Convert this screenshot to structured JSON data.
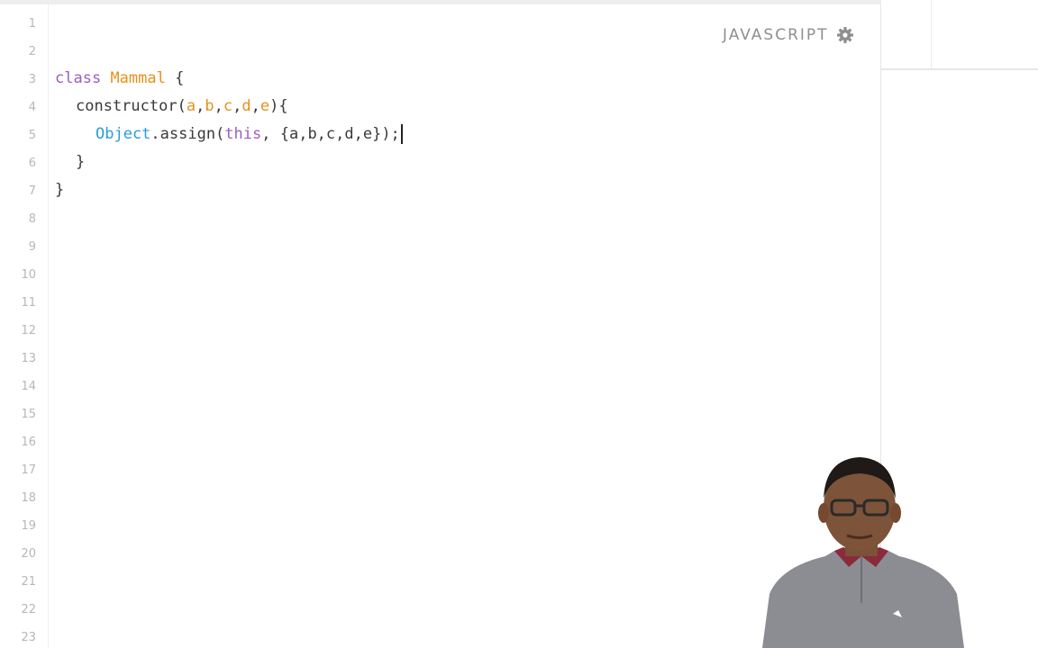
{
  "editor": {
    "language_label": "JAVASCRIPT",
    "settings_icon": "gear-icon",
    "line_numbers": [
      "1",
      "2",
      "3",
      "4",
      "5",
      "6",
      "7",
      "8",
      "9",
      "10",
      "11",
      "12",
      "13",
      "14",
      "15",
      "16",
      "17",
      "18",
      "19",
      "20",
      "21",
      "22",
      "23"
    ],
    "code": {
      "l3_kw": "class",
      "l3_name": "Mammal",
      "l3_rest": " {",
      "l4_fn": "constructor(",
      "l4_p1": "a",
      "l4_p2": "b",
      "l4_p3": "c",
      "l4_p4": "d",
      "l4_p5": "e",
      "l4_end": "){",
      "l5_obj": "Object",
      "l5_call": ".assign(",
      "l5_this": "this",
      "l5_args": ", {a,b,c,d,e});",
      "l6": "}",
      "l7": "}"
    }
  },
  "colors": {
    "keyword": "#9a5fc2",
    "class_name": "#e8901a",
    "builtin": "#2a9bd9",
    "text": "#3a3a3a",
    "line_number": "#b7b7b7"
  },
  "presenter_icon": "presenter-video-icon"
}
